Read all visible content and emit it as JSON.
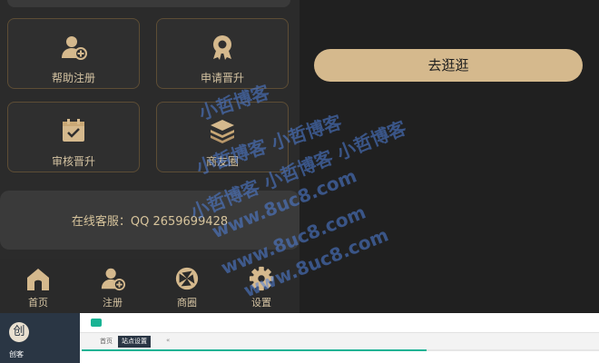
{
  "tiles": [
    {
      "label": "帮助注册",
      "icon": "user-add-icon"
    },
    {
      "label": "申请晋升",
      "icon": "award-badge-icon"
    },
    {
      "label": "审核晋升",
      "icon": "calendar-check-icon"
    },
    {
      "label": "商友圈",
      "icon": "layers-icon"
    }
  ],
  "service": {
    "text": "在线客服：QQ 2659699428"
  },
  "nav": [
    {
      "label": "首页",
      "icon": "home-icon"
    },
    {
      "label": "注册",
      "icon": "user-add-icon"
    },
    {
      "label": "商圈",
      "icon": "aperture-icon"
    },
    {
      "label": "设置",
      "icon": "gear-icon"
    }
  ],
  "go_button": "去逛逛",
  "watermark": [
    "小哲博客",
    "小哲博客 小哲博客",
    "小哲博客 小哲博客 小哲博客",
    "www.8uc8.com",
    "www.8uc8.com",
    "www.8uc8.com"
  ],
  "admin": {
    "logo_char": "创",
    "brand": "创客",
    "tabs": [
      "首页",
      "站点设置"
    ]
  },
  "colors": {
    "accent": "#d5b98d",
    "tile_border": "#5d4d35",
    "admin_sidebar": "#2a3644",
    "admin_accent": "#19b394"
  }
}
